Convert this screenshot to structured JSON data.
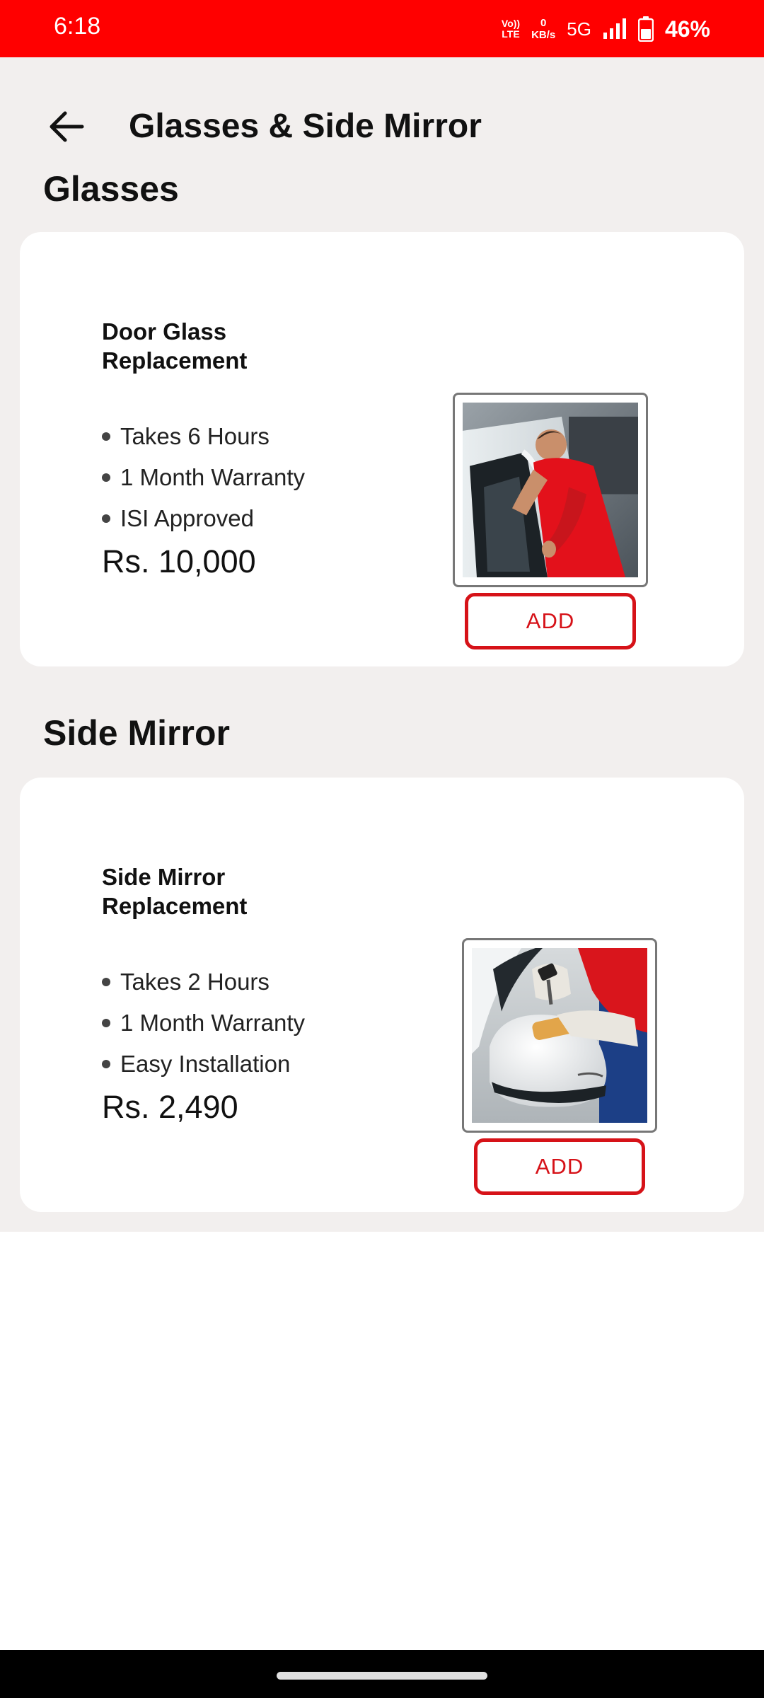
{
  "status_bar": {
    "time": "6:18",
    "volte_top": "Vo))",
    "volte_bottom": "LTE",
    "net_speed_value": "0",
    "net_speed_unit": "KB/s",
    "network": "5G",
    "battery_percent": "46%"
  },
  "header": {
    "title": "Glasses & Side Mirror"
  },
  "sections": [
    {
      "title": "Glasses",
      "service": {
        "name": "Door Glass Replacement",
        "features": [
          "Takes 6 Hours",
          "1 Month Warranty",
          "ISI Approved"
        ],
        "price": "Rs. 10,000",
        "button_label": "ADD"
      }
    },
    {
      "title": "Side Mirror",
      "service": {
        "name": "Side Mirror Replacement",
        "features": [
          "Takes 2 Hours",
          "1 Month Warranty",
          "Easy Installation"
        ],
        "price": "Rs. 2,490",
        "button_label": "ADD"
      }
    }
  ],
  "colors": {
    "accent": "#ff0000",
    "button_border": "#d61218",
    "page_background": "#f2efee",
    "card_background": "#ffffff"
  },
  "icons": {
    "back": "arrow-left-icon",
    "signal": "signal-bars-icon",
    "battery": "battery-icon"
  }
}
